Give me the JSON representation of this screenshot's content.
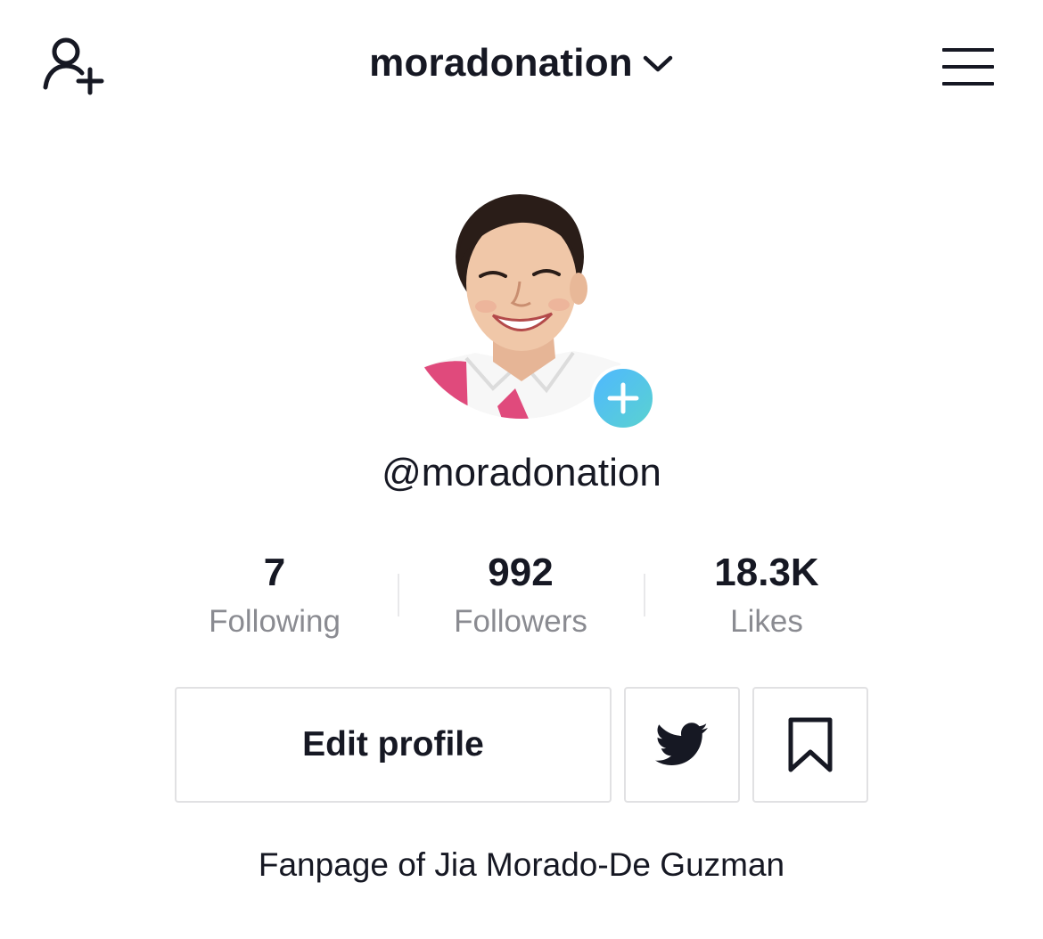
{
  "header": {
    "add_user_icon": "add-user-icon",
    "title": "moradonation",
    "title_icon": "chevron-down-icon",
    "menu_icon": "hamburger-menu-icon"
  },
  "profile": {
    "handle": "@moradonation",
    "add_photo_icon": "plus-icon",
    "accent_gradient": [
      "#4fb8ff",
      "#5ad2d0"
    ]
  },
  "stats": [
    {
      "value": "7",
      "label": "Following"
    },
    {
      "value": "992",
      "label": "Followers"
    },
    {
      "value": "18.3K",
      "label": "Likes"
    }
  ],
  "actions": {
    "edit_label": "Edit profile",
    "twitter_icon": "twitter-icon",
    "bookmark_icon": "bookmark-icon"
  },
  "bio": "Fanpage of Jia Morado-De Guzman",
  "colors": {
    "text": "#161823",
    "secondary_text": "#8a8b91",
    "border": "#e1e1e3"
  }
}
